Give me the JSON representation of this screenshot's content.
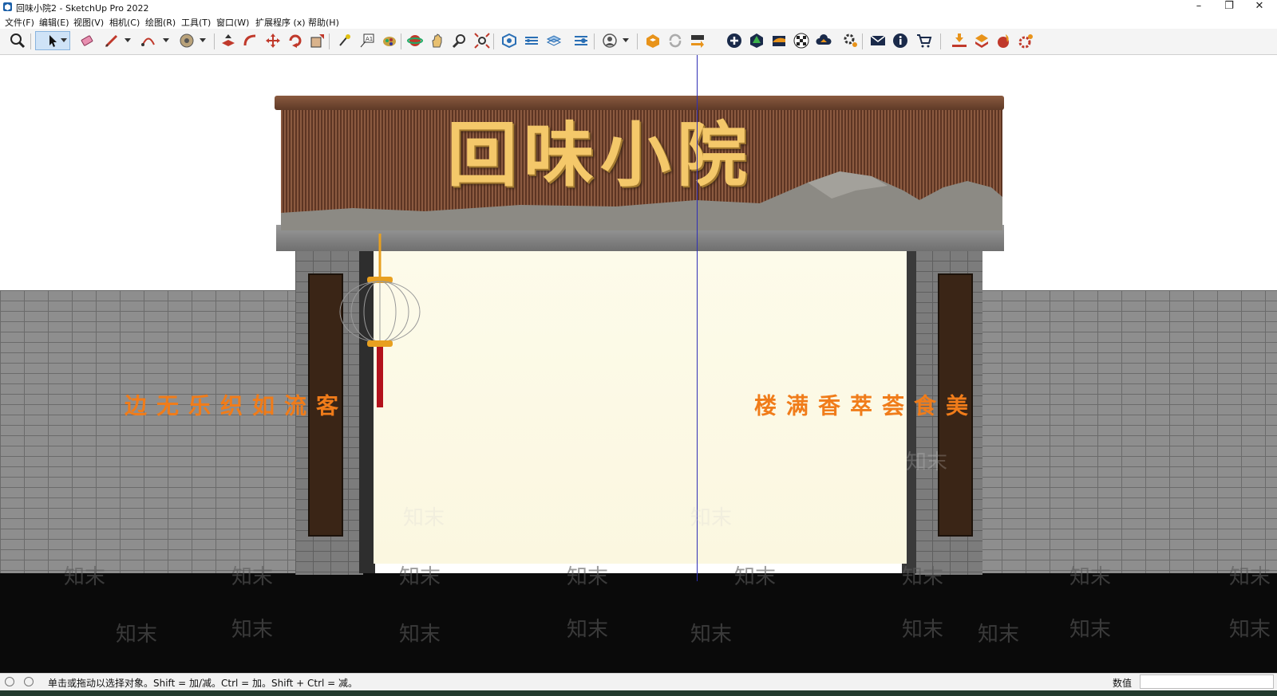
{
  "window": {
    "title": "回味小院2 - SketchUp Pro 2022",
    "minimize_label": "–",
    "restore_label": "❐",
    "close_label": "✕"
  },
  "menu": [
    {
      "label": "文件(F)"
    },
    {
      "label": "编辑(E)"
    },
    {
      "label": "视图(V)"
    },
    {
      "label": "相机(C)"
    },
    {
      "label": "绘图(R)"
    },
    {
      "label": "工具(T)"
    },
    {
      "label": "窗口(W)"
    },
    {
      "label": "扩展程序 (x)"
    },
    {
      "label": "帮助(H)"
    }
  ],
  "toolbar": {
    "tools": [
      "search-icon",
      "select-arrow-icon",
      "eraser-icon",
      "pencil-icon",
      "arc-icon",
      "tape-disc-icon",
      "push-pull-icon",
      "follow-me-icon",
      "move-icon",
      "rotate-icon",
      "scale-icon",
      "paint-bucket-icon",
      "text-icon",
      "material-icon",
      "orbit-icon",
      "hand-icon",
      "zoom-icon",
      "zoom-extents-icon",
      "section-icon",
      "layers-icon",
      "styles-icon",
      "components-icon",
      "account-icon",
      "warehouse-icon",
      "refresh-icon",
      "share-icon",
      "add-icon",
      "tree-icon",
      "terrain-icon",
      "checker-icon",
      "cloud-upload-icon",
      "settings-icon",
      "mail-icon",
      "info-icon",
      "cart-icon",
      "ext-download-icon",
      "ext-shape-icon",
      "ext-fire-icon",
      "ext-gear-icon"
    ]
  },
  "scene": {
    "sign_title": "回味小院",
    "couplet_left": [
      "客",
      "流",
      "如",
      "织",
      "乐",
      "无",
      "边"
    ],
    "couplet_right": [
      "美",
      "食",
      "荟",
      "萃",
      "香",
      "满",
      "楼"
    ],
    "watermark": "知末",
    "colors": {
      "sign_text": "#f4c86a",
      "couplet_text": "#f07c1a",
      "board": "#7a4a33",
      "door": "#fdfbea",
      "axis": "#2f2fb5"
    }
  },
  "status": {
    "hint": "单击或拖动以选择对象。Shift = 加/减。Ctrl = 加。Shift + Ctrl = 减。",
    "measurements_label": "数值",
    "measurements_value": ""
  }
}
